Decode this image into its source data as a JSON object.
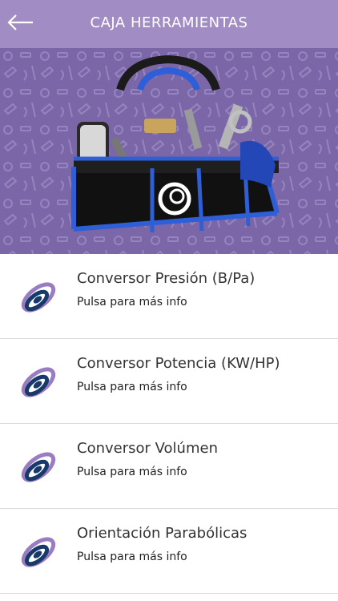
{
  "header": {
    "title": "CAJA HERRAMIENTAS",
    "back_icon": "arrow-left-icon",
    "background_color": "#a18cc3"
  },
  "hero": {
    "image": "toolbag-photo",
    "background_color": "#7b67a8",
    "bag_color": "#2f5fd6"
  },
  "list": {
    "items": [
      {
        "title": "Conversor Presión (B/Pa)",
        "subtitle": "Pulsa para más info",
        "icon": "brand-swirl-icon"
      },
      {
        "title": "Conversor Potencia (KW/HP)",
        "subtitle": "Pulsa para más info",
        "icon": "brand-swirl-icon"
      },
      {
        "title": "Conversor Volúmen",
        "subtitle": "Pulsa para más info",
        "icon": "brand-swirl-icon"
      },
      {
        "title": "Orientación Parabólicas",
        "subtitle": "Pulsa para más info",
        "icon": "brand-swirl-icon"
      }
    ]
  },
  "colors": {
    "accent": "#a18cc3",
    "logo_dark": "#173a6b",
    "logo_light": "#9a7dc0"
  }
}
